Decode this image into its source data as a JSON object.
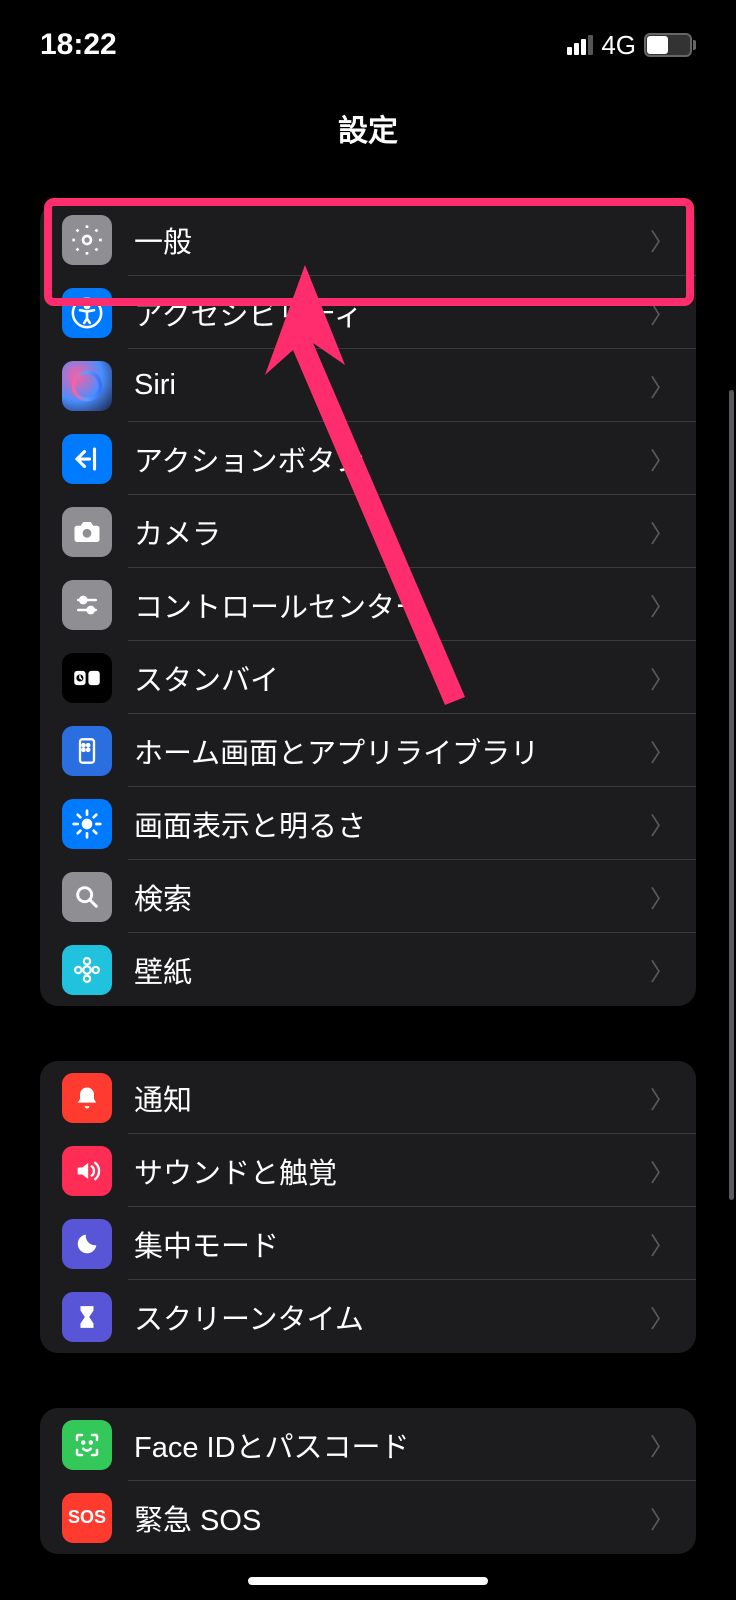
{
  "status": {
    "time": "18:22",
    "network": "4G",
    "battery": "47"
  },
  "header": {
    "title": "設定"
  },
  "sections": [
    {
      "items": [
        {
          "id": "general",
          "label": "一般",
          "icon": "gear"
        },
        {
          "id": "accessibility",
          "label": "アクセシビリティ",
          "icon": "accessibility"
        },
        {
          "id": "siri",
          "label": "Siri",
          "icon": "siri"
        },
        {
          "id": "action-button",
          "label": "アクションボタン",
          "icon": "action"
        },
        {
          "id": "camera",
          "label": "カメラ",
          "icon": "camera"
        },
        {
          "id": "control-center",
          "label": "コントロールセンター",
          "icon": "control"
        },
        {
          "id": "standby",
          "label": "スタンバイ",
          "icon": "standby"
        },
        {
          "id": "home-screen",
          "label": "ホーム画面とアプリライブラリ",
          "icon": "home"
        },
        {
          "id": "display",
          "label": "画面表示と明るさ",
          "icon": "display"
        },
        {
          "id": "search",
          "label": "検索",
          "icon": "search"
        },
        {
          "id": "wallpaper",
          "label": "壁紙",
          "icon": "wallpaper"
        }
      ]
    },
    {
      "items": [
        {
          "id": "notifications",
          "label": "通知",
          "icon": "notifications"
        },
        {
          "id": "sounds",
          "label": "サウンドと触覚",
          "icon": "sounds"
        },
        {
          "id": "focus",
          "label": "集中モード",
          "icon": "focus"
        },
        {
          "id": "screen-time",
          "label": "スクリーンタイム",
          "icon": "screentime"
        }
      ]
    },
    {
      "items": [
        {
          "id": "face-id",
          "label": "Face IDとパスコード",
          "icon": "faceid"
        },
        {
          "id": "sos",
          "label": "緊急 SOS",
          "icon": "sos"
        }
      ]
    }
  ],
  "annotation": {
    "highlight_target": "general"
  }
}
